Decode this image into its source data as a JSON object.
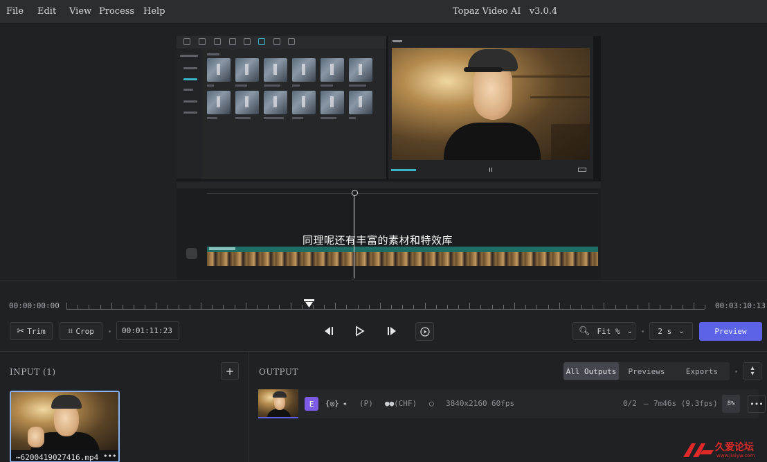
{
  "menu": {
    "items": [
      "File",
      "Edit",
      "View",
      "Process",
      "Help"
    ]
  },
  "app": {
    "title": "Topaz Video AI",
    "version": "v3.0.4"
  },
  "preview": {
    "subtitle": "同理呢还有丰富的素材和特效库"
  },
  "scrubber": {
    "start": "00:00:00:00",
    "end": "00:03:10:13",
    "position_fraction": 0.38
  },
  "controls": {
    "trim_label": "Trim",
    "crop_label": "Crop",
    "timecode": "00:01:11:23",
    "zoom_label": "Fit %",
    "duration_label": "2 s",
    "preview_label": "Preview"
  },
  "input": {
    "title": "INPUT (1)",
    "file_name": "⋯6200419027416.mp4",
    "add_label": "+"
  },
  "output": {
    "title": "OUTPUT",
    "tabs": [
      {
        "label": "All Outputs",
        "active": true
      },
      {
        "label": "Previews",
        "active": false
      },
      {
        "label": "Exports",
        "active": false
      }
    ],
    "row": {
      "badge": "E",
      "p_label": "(P)",
      "chf_label": "(CHF)",
      "resolution": "3840x2160",
      "fps": "60fps",
      "progress": "0/2",
      "eta": "7m46s (9.3fps)",
      "percent": "8%"
    }
  },
  "watermark": {
    "text": "久爱论坛",
    "url": "www.jiaiyw.com"
  },
  "colors": {
    "accent": "#5c63e6",
    "badge": "#7c5ce6",
    "selection": "#8ab4f0",
    "teal": "#3bb6c8"
  }
}
